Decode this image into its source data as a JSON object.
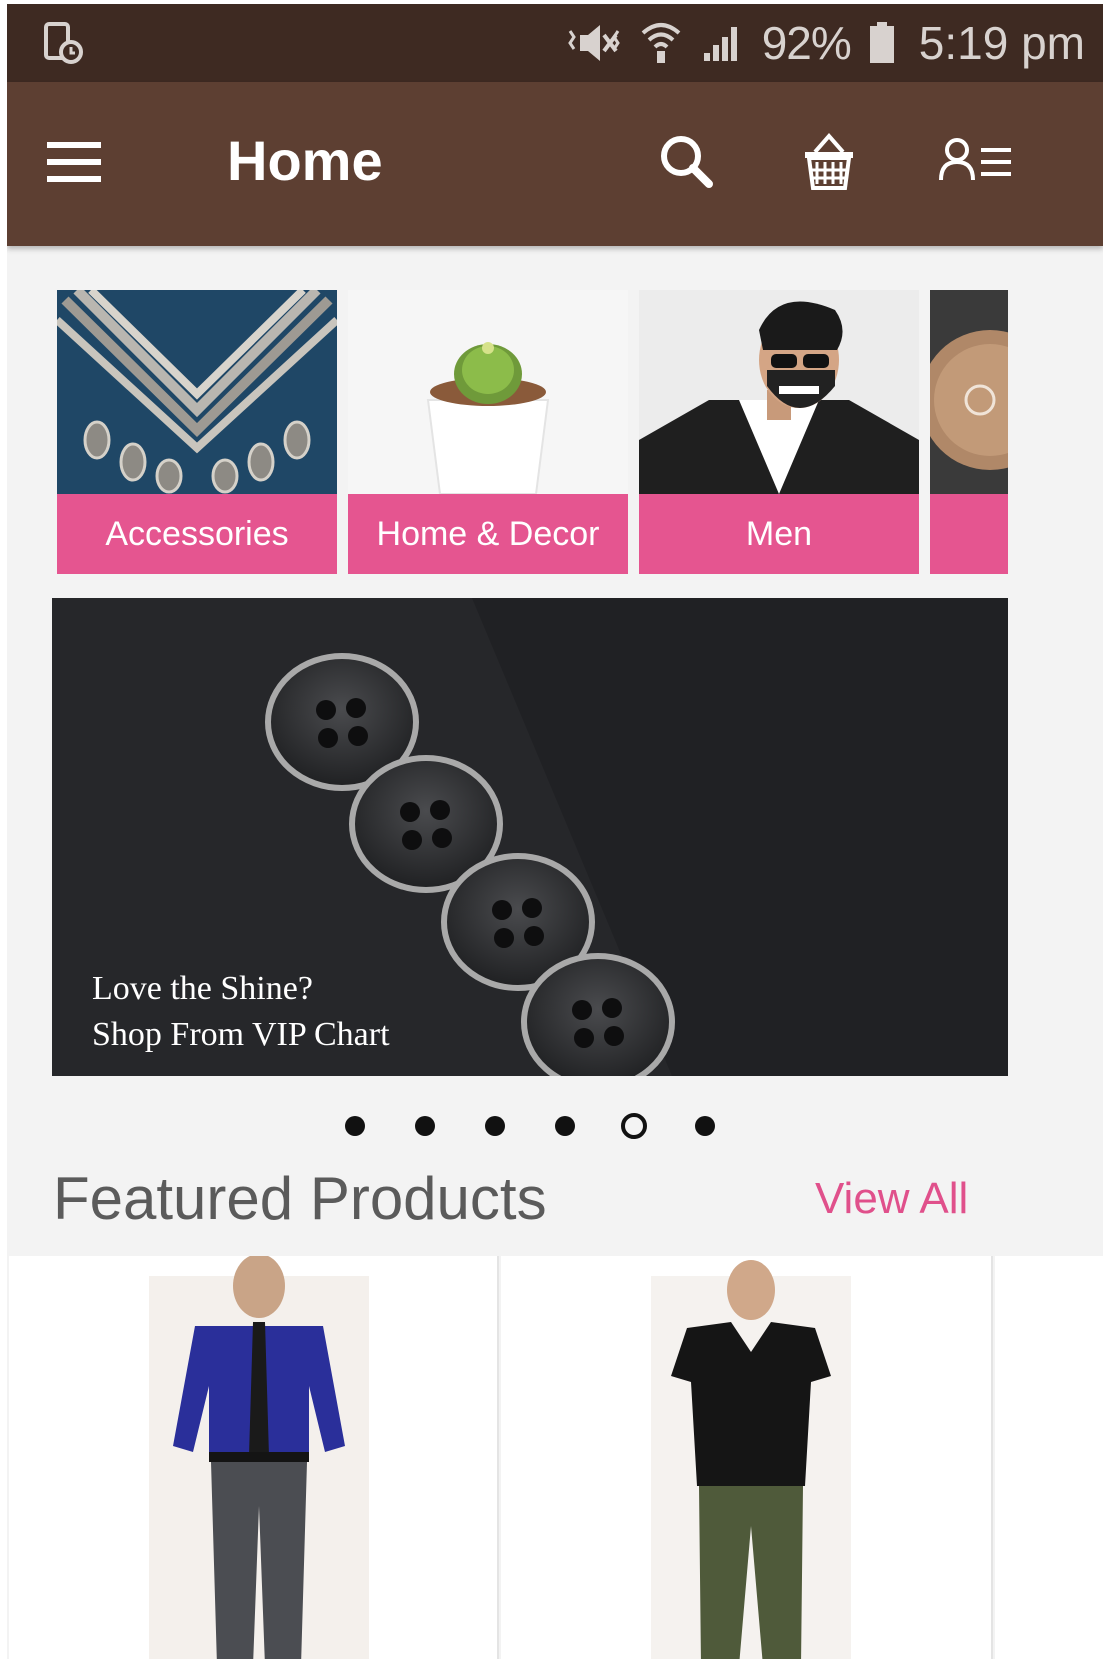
{
  "status_bar": {
    "battery_percent": "92%",
    "time": "5:19 pm",
    "icons": [
      "screenshot-icon",
      "mute-icon",
      "wifi-icon",
      "signal-icon",
      "battery-icon"
    ]
  },
  "toolbar": {
    "title": "Home",
    "icons": [
      "menu-icon",
      "search-icon",
      "basket-icon",
      "account-menu-icon"
    ],
    "bg_color": "#5d3f32"
  },
  "categories": [
    {
      "label": "Accessories"
    },
    {
      "label": "Home & Decor"
    },
    {
      "label": "Men"
    },
    {
      "label": ""
    }
  ],
  "banner": {
    "caption_line1": "Love the Shine?",
    "caption_line2": "Shop From VIP Chart"
  },
  "carousel": {
    "count": 6,
    "active_index": 4
  },
  "featured": {
    "title": "Featured Products",
    "view_all": "View All",
    "accent_color": "#e0508b"
  }
}
